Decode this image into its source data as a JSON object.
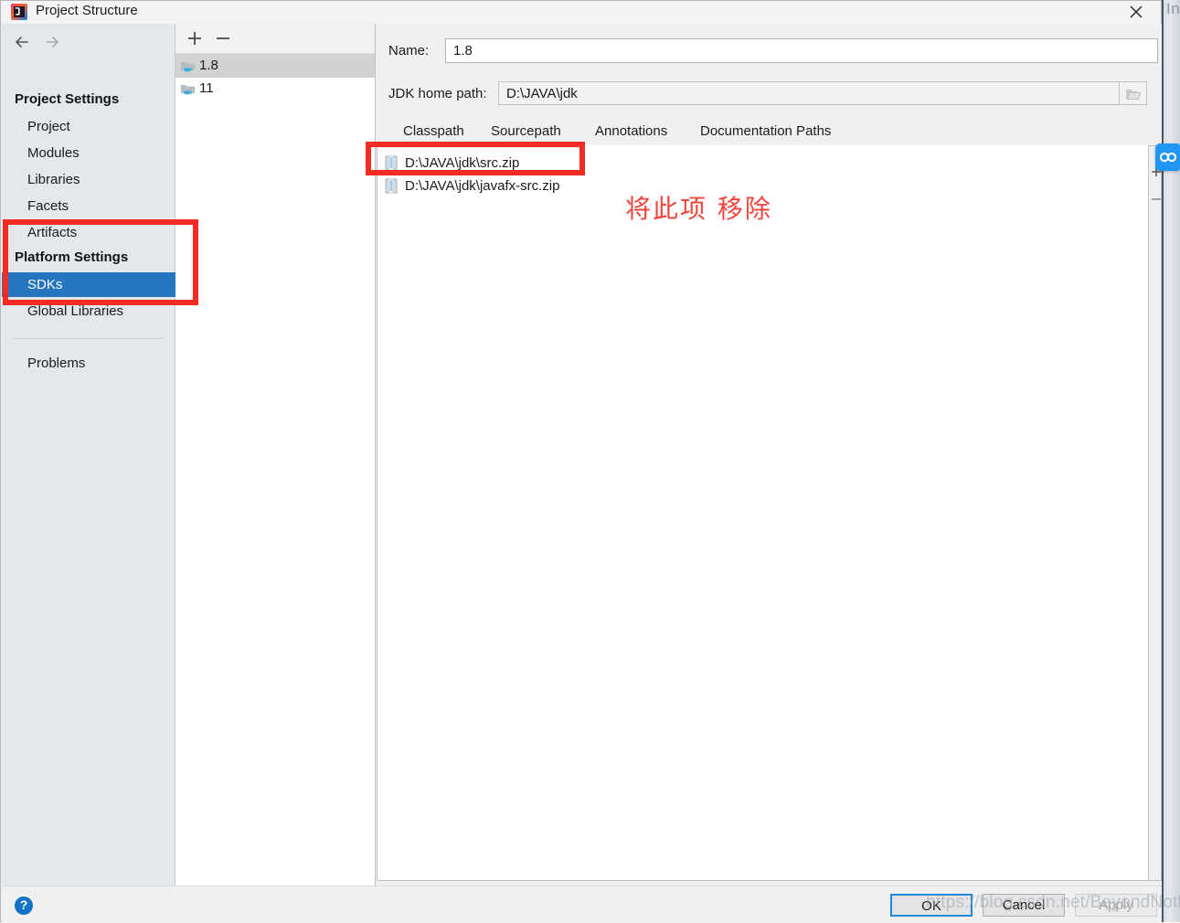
{
  "window": {
    "title": "Project Structure",
    "app_icon": "intellij-idea-icon",
    "close_label": "×"
  },
  "background": {
    "edge_text": "In"
  },
  "sidebar": {
    "nav": {
      "back_icon": "arrow-left-icon",
      "forward_icon": "arrow-right-icon"
    },
    "groups": [
      {
        "label": "Project Settings",
        "items": [
          {
            "label": "Project",
            "selected": false
          },
          {
            "label": "Modules",
            "selected": false
          },
          {
            "label": "Libraries",
            "selected": false
          },
          {
            "label": "Facets",
            "selected": false
          },
          {
            "label": "Artifacts",
            "selected": false
          }
        ]
      },
      {
        "label": "Platform Settings",
        "items": [
          {
            "label": "SDKs",
            "selected": true
          },
          {
            "label": "Global Libraries",
            "selected": false
          }
        ]
      }
    ],
    "footer_items": [
      {
        "label": "Problems",
        "selected": false
      }
    ]
  },
  "sdk_list": {
    "toolbar": {
      "add_icon": "plus-icon",
      "remove_icon": "minus-icon",
      "add_label": "+",
      "remove_label": "−"
    },
    "items": [
      {
        "label": "1.8",
        "selected": true,
        "icon": "jdk-folder-icon"
      },
      {
        "label": "11",
        "selected": false,
        "icon": "jdk-folder-icon"
      }
    ]
  },
  "details": {
    "name_label": "Name:",
    "name_value": "1.8",
    "home_label": "JDK home path:",
    "home_value": "D:\\JAVA\\jdk",
    "browse_icon": "folder-open-icon",
    "tabs": [
      {
        "label": "Classpath",
        "active": false
      },
      {
        "label": "Sourcepath",
        "active": true
      },
      {
        "label": "Annotations",
        "active": false
      },
      {
        "label": "Documentation Paths",
        "active": false
      }
    ],
    "files": [
      {
        "path": "D:\\JAVA\\jdk\\src.zip",
        "icon": "zip-archive-icon"
      },
      {
        "path": "D:\\JAVA\\jdk\\javafx-src.zip",
        "icon": "zip-archive-icon"
      }
    ],
    "rail": {
      "add_label": "+",
      "remove_label": "−"
    },
    "badge_icon": "link-chain-icon"
  },
  "bottom_bar": {
    "help_label": "?",
    "buttons": [
      {
        "label": "OK",
        "style": "default"
      },
      {
        "label": "Cancel",
        "style": "normal"
      },
      {
        "label": "Apply",
        "style": "disabled"
      }
    ]
  },
  "annotations": {
    "platform_box": "highlight-platform-settings",
    "srczip_box": "highlight-src-zip-entry",
    "note_text": "将此项 移除"
  },
  "watermark": {
    "text": "https://blog.csdn.net/BeyondNothing"
  },
  "colors": {
    "accent_blue": "#2675bf",
    "annotation_red": "#f22c22",
    "badge_blue": "#2196f3",
    "selection_gray": "#d2d2d2"
  }
}
